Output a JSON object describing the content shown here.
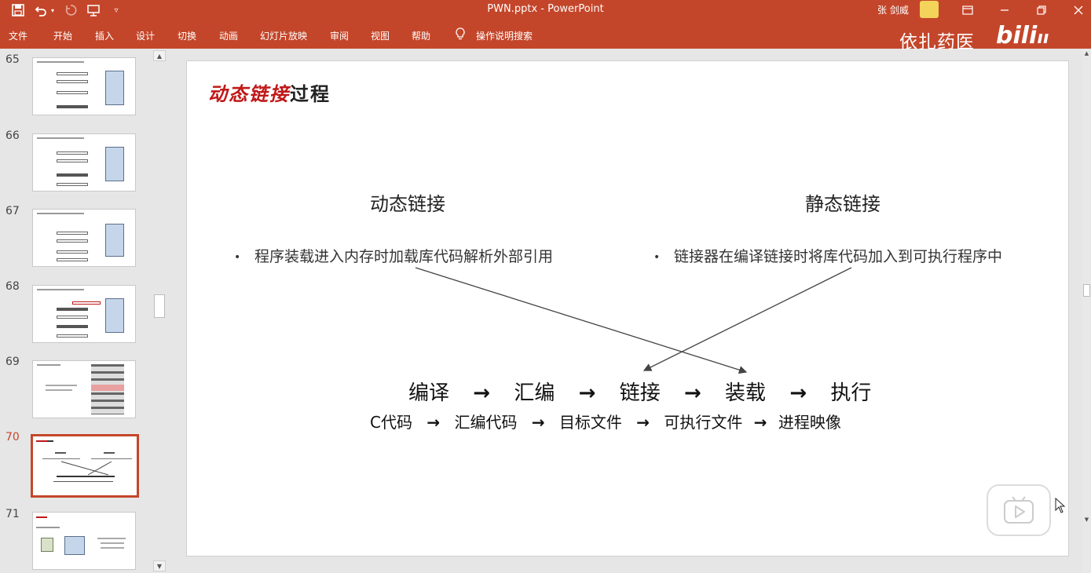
{
  "titlebar": {
    "doc_title": "PWN.pptx  -  PowerPoint",
    "user_name": "张 剑威",
    "icons": [
      "save-icon",
      "undo-icon",
      "undo-dropdown-icon",
      "redo-icon",
      "present-from-start-icon",
      "customize-qat-icon",
      "ribbon-display-icon",
      "minimize-icon",
      "restore-icon",
      "close-icon"
    ]
  },
  "ribbon": {
    "tabs": [
      "文件",
      "开始",
      "插入",
      "设计",
      "切换",
      "动画",
      "幻灯片放映",
      "审阅",
      "视图",
      "帮助"
    ],
    "tell_me": "操作说明搜索",
    "watermark_text": "依扎药医",
    "watermark_logo": "bilibili"
  },
  "thumbnails": [
    {
      "num": "65",
      "selected": false
    },
    {
      "num": "66",
      "selected": false
    },
    {
      "num": "67",
      "selected": false
    },
    {
      "num": "68",
      "selected": false
    },
    {
      "num": "69",
      "selected": false
    },
    {
      "num": "70",
      "selected": true
    },
    {
      "num": "71",
      "selected": false
    }
  ],
  "slide": {
    "title_red": "动态链接",
    "title_black": "过程",
    "left_heading": "动态链接",
    "right_heading": "静态链接",
    "left_bullet": "程序装载进入内存时加载库代码解析外部引用",
    "right_bullet": "链接器在编译链接时将库代码加入到可执行程序中",
    "flow_steps": [
      "编译",
      "汇编",
      "链接",
      "装载",
      "执行"
    ],
    "flow_arrow": "→",
    "artifacts": [
      "C代码",
      "汇编代码",
      "目标文件",
      "可执行文件",
      "进程映像"
    ]
  },
  "colors": {
    "accent": "#c4462a",
    "title_red": "#c01818"
  }
}
